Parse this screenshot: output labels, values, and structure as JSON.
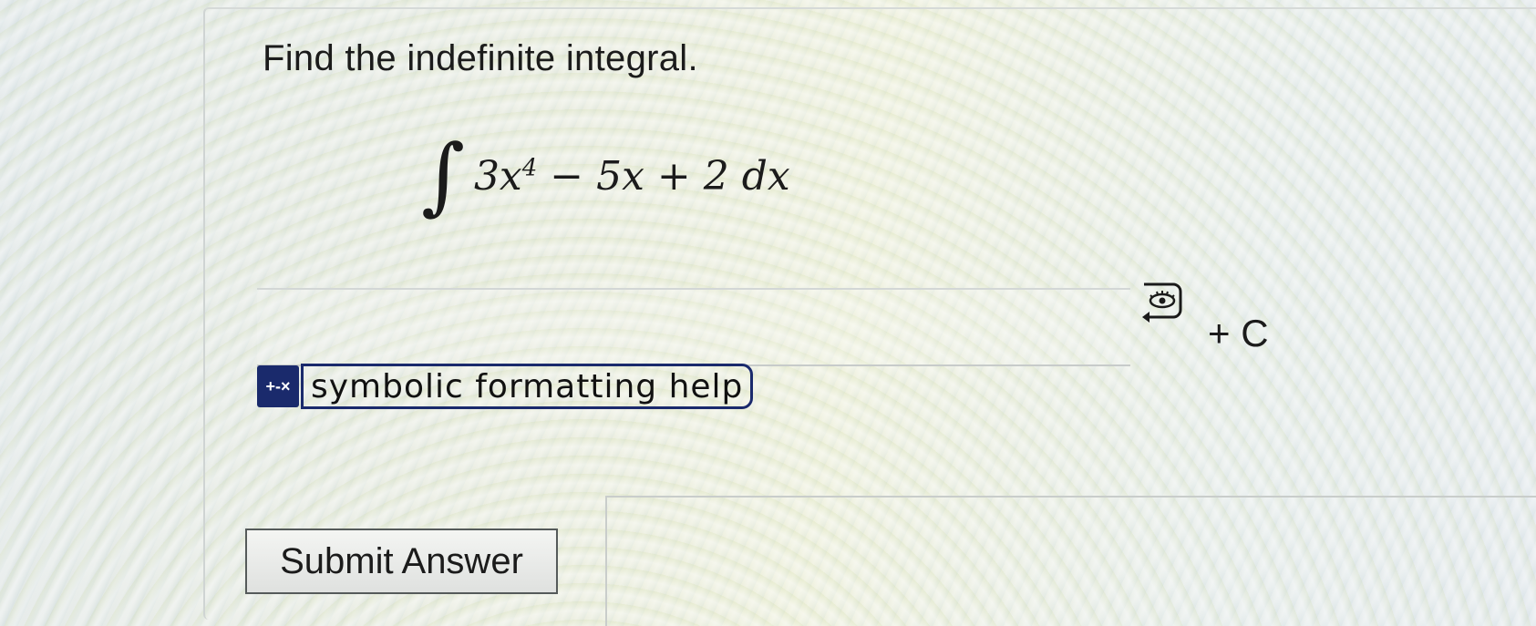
{
  "question": {
    "prompt": "Find the indefinite integral.",
    "integrand": {
      "term1_coef": "3x",
      "term1_exp": "4",
      "rest": " − 5x + 2 dx"
    }
  },
  "answer": {
    "value": "",
    "suffix": "+ C"
  },
  "help": {
    "icon_text": "+-×",
    "label": "symbolic formatting help"
  },
  "actions": {
    "submit_label": "Submit Answer"
  },
  "colors": {
    "help_accent": "#1a2a6c"
  }
}
